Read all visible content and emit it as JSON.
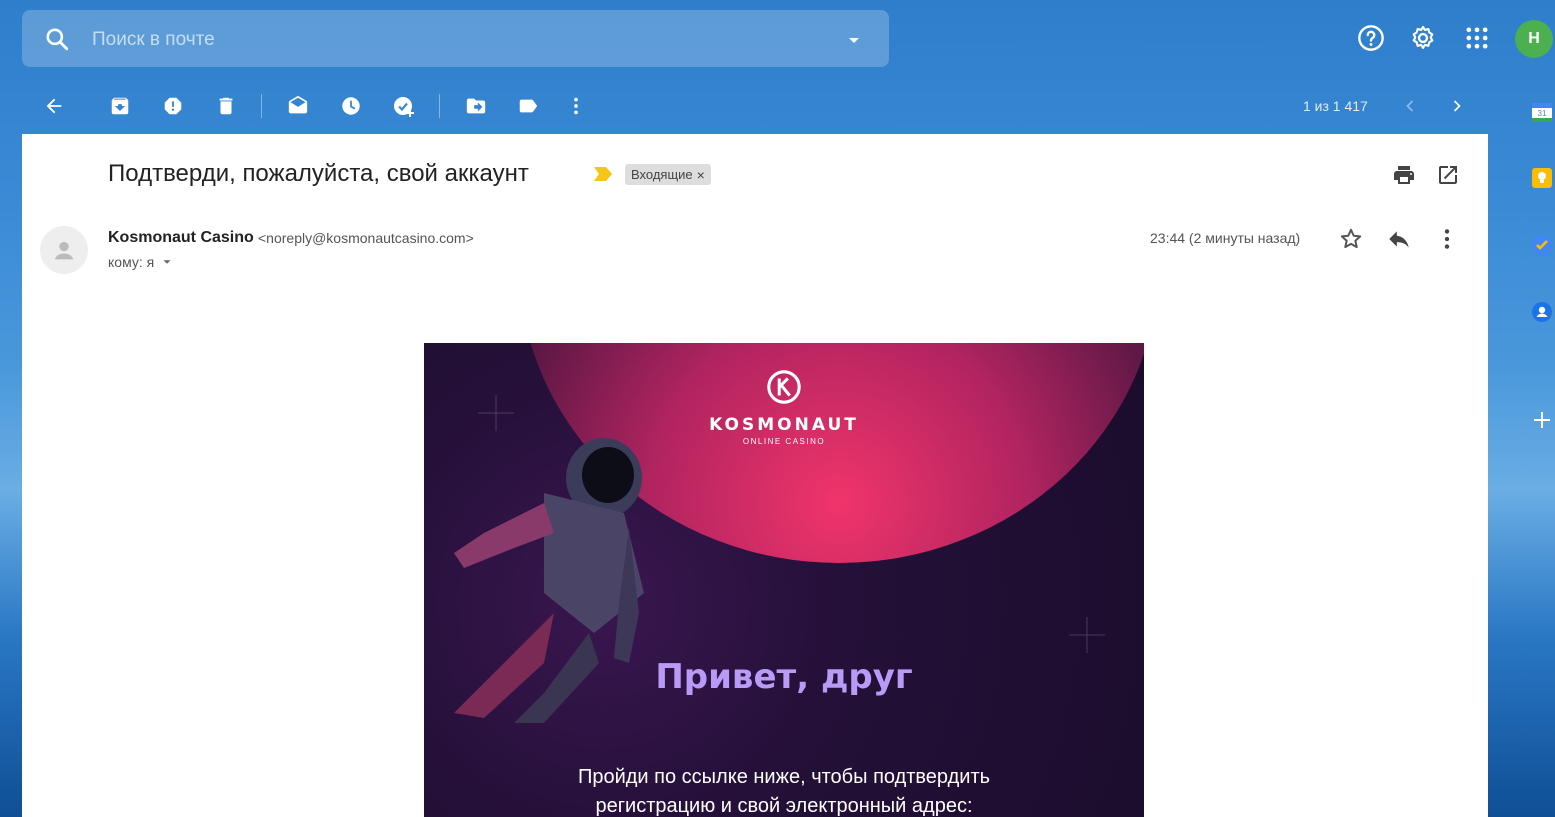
{
  "search": {
    "placeholder": "Поиск в почте"
  },
  "account": {
    "avatar_letter": "Н",
    "avatar_color": "#4caf50"
  },
  "toolbar": {
    "actions": [
      "back-icon",
      "archive-icon",
      "report-spam-icon",
      "delete-icon",
      "mark-unread-icon",
      "snooze-icon",
      "add-to-tasks-icon",
      "move-to-icon",
      "label-icon",
      "more-icon"
    ],
    "pager": "1 из 1 417"
  },
  "side_apps": [
    "calendar-icon",
    "keep-icon",
    "tasks-icon",
    "contacts-icon",
    "add-icon"
  ],
  "mail": {
    "subject": "Подтверди, пожалуйста, свой аккаунт",
    "label": "Входящие",
    "sender_name": "Kosmonaut Casino",
    "sender_email": "<noreply@kosmonautcasino.com>",
    "to": "кому: я",
    "time": "23:44 (2 минуты назад)"
  },
  "promo": {
    "logo_word": "KOSMONAUT",
    "logo_sub": "ONLINE CASINO",
    "heading": "Привет, друг",
    "body": "Пройди по ссылке ниже, чтобы подтвердить регистрацию и свой электронный адрес:",
    "heading_color": "#b89bf6"
  }
}
